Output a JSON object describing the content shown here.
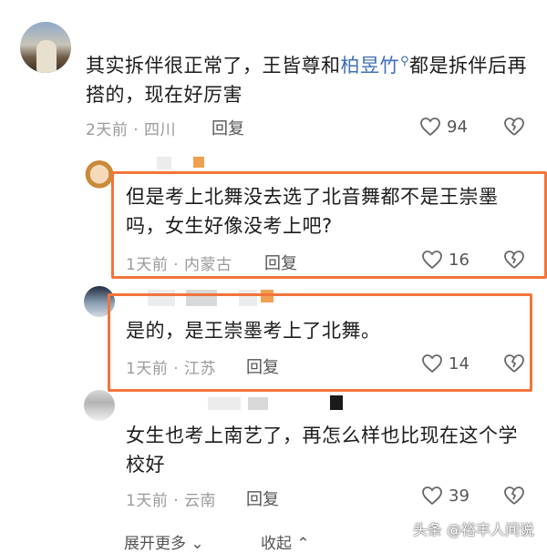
{
  "main_comment": {
    "text_before": "其实拆伴很正常了，王皆尊和",
    "link": "柏昱竹",
    "text_after": "都是拆伴后再搭的，现在好厉害",
    "meta": "2天前 · 四川",
    "reply_label": "回复",
    "likes": "94"
  },
  "replies": [
    {
      "text": "但是考上北舞没去选了北音舞都不是王崇墨吗，女生好像没考上吧?",
      "meta": "1天前 · 内蒙古",
      "reply_label": "回复",
      "likes": "16"
    },
    {
      "text": "是的，是王崇墨考上了北舞。",
      "meta": "1天前 · 江苏",
      "reply_label": "回复",
      "likes": "14"
    },
    {
      "text": "女生也考上南艺了，再怎么样也比现在这个学校好",
      "meta": "1天前 · 云南",
      "reply_label": "回复",
      "likes": "39"
    }
  ],
  "footer": {
    "expand_label": "展开更多",
    "collapse_label": "收起",
    "watermark": "头条 @裕丰人间说"
  },
  "colors": {
    "highlight": "#f3743a",
    "link": "#3d6fb8"
  }
}
